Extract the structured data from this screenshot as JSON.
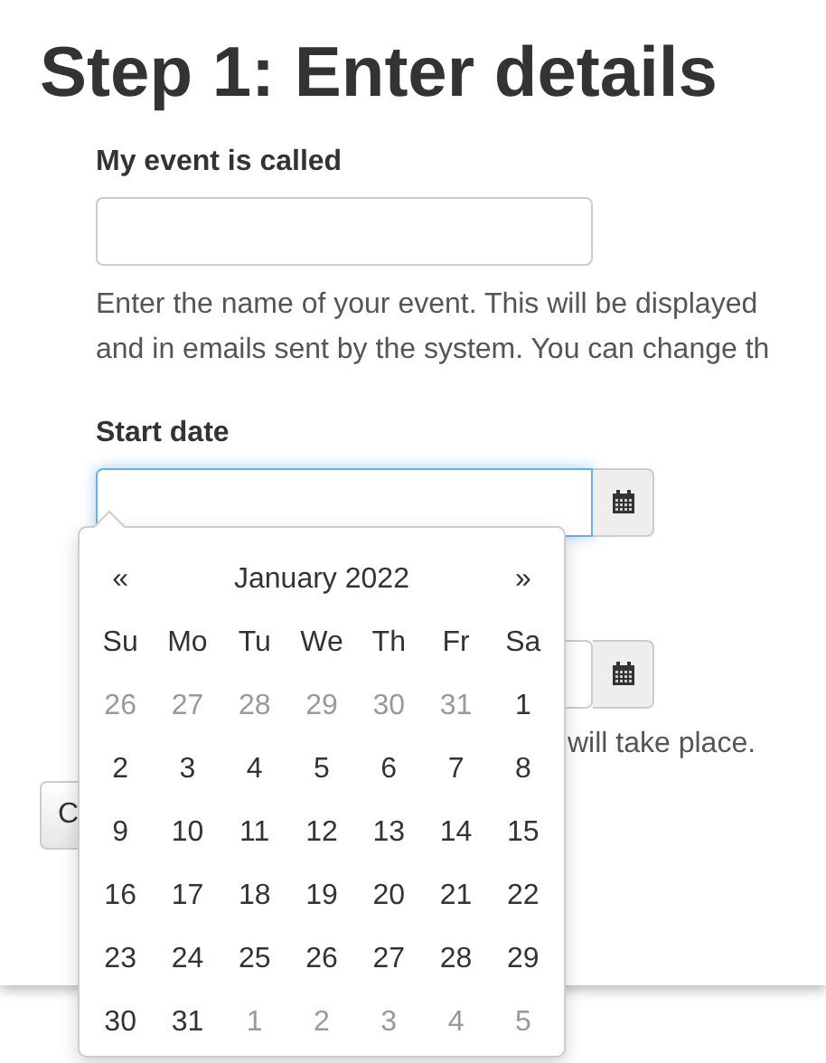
{
  "heading": "Step 1: Enter details",
  "name_field": {
    "label": "My event is called",
    "help_lines": [
      "Enter the name of your event. This will be displayed",
      "and in emails sent by the system. You can change th"
    ]
  },
  "start_field": {
    "label": "Start date",
    "focused": true
  },
  "end_field": {
    "help_visible": "will take place."
  },
  "button_visible": "C",
  "datepicker": {
    "prev": "«",
    "title": "January 2022",
    "next": "»",
    "weekdays": [
      "Su",
      "Mo",
      "Tu",
      "We",
      "Th",
      "Fr",
      "Sa"
    ],
    "weeks": [
      [
        {
          "day": "26",
          "muted": true
        },
        {
          "day": "27",
          "muted": true
        },
        {
          "day": "28",
          "muted": true
        },
        {
          "day": "29",
          "muted": true
        },
        {
          "day": "30",
          "muted": true
        },
        {
          "day": "31",
          "muted": true
        },
        {
          "day": "1",
          "muted": false
        }
      ],
      [
        {
          "day": "2",
          "muted": false
        },
        {
          "day": "3",
          "muted": false
        },
        {
          "day": "4",
          "muted": false
        },
        {
          "day": "5",
          "muted": false
        },
        {
          "day": "6",
          "muted": false
        },
        {
          "day": "7",
          "muted": false
        },
        {
          "day": "8",
          "muted": false
        }
      ],
      [
        {
          "day": "9",
          "muted": false
        },
        {
          "day": "10",
          "muted": false
        },
        {
          "day": "11",
          "muted": false
        },
        {
          "day": "12",
          "muted": false
        },
        {
          "day": "13",
          "muted": false
        },
        {
          "day": "14",
          "muted": false
        },
        {
          "day": "15",
          "muted": false
        }
      ],
      [
        {
          "day": "16",
          "muted": false
        },
        {
          "day": "17",
          "muted": false
        },
        {
          "day": "18",
          "muted": false
        },
        {
          "day": "19",
          "muted": false
        },
        {
          "day": "20",
          "muted": false
        },
        {
          "day": "21",
          "muted": false
        },
        {
          "day": "22",
          "muted": false
        }
      ],
      [
        {
          "day": "23",
          "muted": false
        },
        {
          "day": "24",
          "muted": false
        },
        {
          "day": "25",
          "muted": false
        },
        {
          "day": "26",
          "muted": false
        },
        {
          "day": "27",
          "muted": false
        },
        {
          "day": "28",
          "muted": false
        },
        {
          "day": "29",
          "muted": false
        }
      ],
      [
        {
          "day": "30",
          "muted": false
        },
        {
          "day": "31",
          "muted": false
        },
        {
          "day": "1",
          "muted": true
        },
        {
          "day": "2",
          "muted": true
        },
        {
          "day": "3",
          "muted": true
        },
        {
          "day": "4",
          "muted": true
        },
        {
          "day": "5",
          "muted": true
        }
      ]
    ]
  }
}
